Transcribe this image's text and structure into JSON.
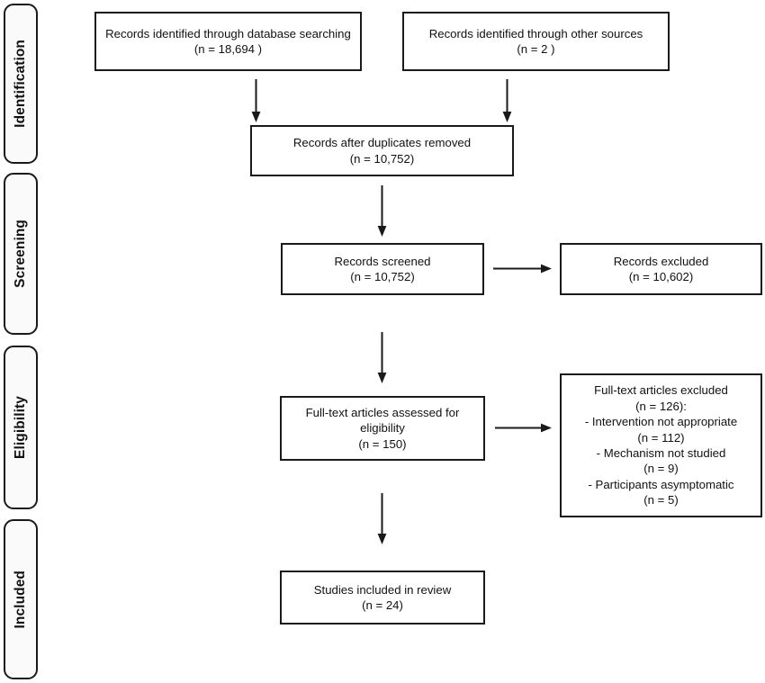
{
  "diagram": {
    "type": "prisma-flow-diagram",
    "line_color": "#1a1a1a",
    "box_fill": "#ffffff",
    "tab_fill": "#fafafa",
    "text_color": "#111111"
  },
  "stages": [
    {
      "id": "identification",
      "label": "Identification"
    },
    {
      "id": "screening",
      "label": "Screening"
    },
    {
      "id": "eligibility",
      "label": "Eligibility"
    },
    {
      "id": "included",
      "label": "Included"
    }
  ],
  "boxes": {
    "db_search": {
      "title": "Records identified through database searching",
      "count": "(n = 18,694 )",
      "text": "Records identified through database searching\n(n = 18,694 )"
    },
    "other_sources": {
      "title": "Records identified through other sources",
      "count": "(n = 2 )",
      "text": "Records identified through other sources\n(n = 2 )"
    },
    "duplicates_removed": {
      "title": "Records after duplicates removed",
      "count": "(n = 10,752)",
      "text": "Records after duplicates removed\n(n = 10,752)"
    },
    "records_screened": {
      "title": "Records screened",
      "count": "(n = 10,752)",
      "text": "Records screened\n(n = 10,752)"
    },
    "records_excluded": {
      "title": "Records excluded",
      "count": "(n = 10,602)",
      "text": "Records excluded\n(n = 10,602)"
    },
    "fulltext_assessed": {
      "title": "Full-text articles assessed for eligibility",
      "count": "(n = 150)",
      "text": "Full-text articles assessed for\neligibility\n(n = 150)"
    },
    "fulltext_excluded": {
      "title": "Full-text articles excluded",
      "count": "(n = 126):",
      "reasons": [
        {
          "label": "- Intervention not appropriate",
          "count": "(n = 112)"
        },
        {
          "label": "- Mechanism not studied",
          "count": "(n = 9)"
        },
        {
          "label": "- Participants asymptomatic",
          "count": "(n = 5)"
        }
      ],
      "text": "Full-text articles excluded\n(n = 126):\n- Intervention not appropriate\n(n = 112)\n- Mechanism not studied\n(n = 9)\n- Participants asymptomatic\n(n = 5)"
    },
    "studies_included": {
      "title": "Studies included in review",
      "count": "(n = 24)",
      "text": "Studies included in review\n(n = 24)"
    }
  },
  "connectors": [
    {
      "id": "db-search-to-duplicates",
      "direction": "down"
    },
    {
      "id": "other-sources-to-duplicates",
      "direction": "down"
    },
    {
      "id": "duplicates-to-screened",
      "direction": "down"
    },
    {
      "id": "screened-to-excluded",
      "direction": "right"
    },
    {
      "id": "screened-to-fulltext",
      "direction": "down"
    },
    {
      "id": "fulltext-to-fulltext-excluded",
      "direction": "right"
    },
    {
      "id": "fulltext-to-included",
      "direction": "down"
    }
  ],
  "chart_data": {
    "type": "diagram",
    "title": "PRISMA flow diagram",
    "nodes": [
      {
        "id": "db_search",
        "stage": "Identification",
        "label": "Records identified through database searching",
        "n": 18694
      },
      {
        "id": "other_sources",
        "stage": "Identification",
        "label": "Records identified through other sources",
        "n": 2
      },
      {
        "id": "duplicates_removed",
        "stage": "Identification",
        "label": "Records after duplicates removed",
        "n": 10752
      },
      {
        "id": "records_screened",
        "stage": "Screening",
        "label": "Records screened",
        "n": 10752
      },
      {
        "id": "records_excluded",
        "stage": "Screening",
        "label": "Records excluded",
        "n": 10602
      },
      {
        "id": "fulltext_assessed",
        "stage": "Eligibility",
        "label": "Full-text articles assessed for eligibility",
        "n": 150
      },
      {
        "id": "fulltext_excluded",
        "stage": "Eligibility",
        "label": "Full-text articles excluded",
        "n": 126
      },
      {
        "id": "studies_included",
        "stage": "Included",
        "label": "Studies included in review",
        "n": 24
      }
    ],
    "edges": [
      {
        "from": "db_search",
        "to": "duplicates_removed"
      },
      {
        "from": "other_sources",
        "to": "duplicates_removed"
      },
      {
        "from": "duplicates_removed",
        "to": "records_screened"
      },
      {
        "from": "records_screened",
        "to": "records_excluded"
      },
      {
        "from": "records_screened",
        "to": "fulltext_assessed"
      },
      {
        "from": "fulltext_assessed",
        "to": "fulltext_excluded"
      },
      {
        "from": "fulltext_assessed",
        "to": "studies_included"
      }
    ]
  }
}
